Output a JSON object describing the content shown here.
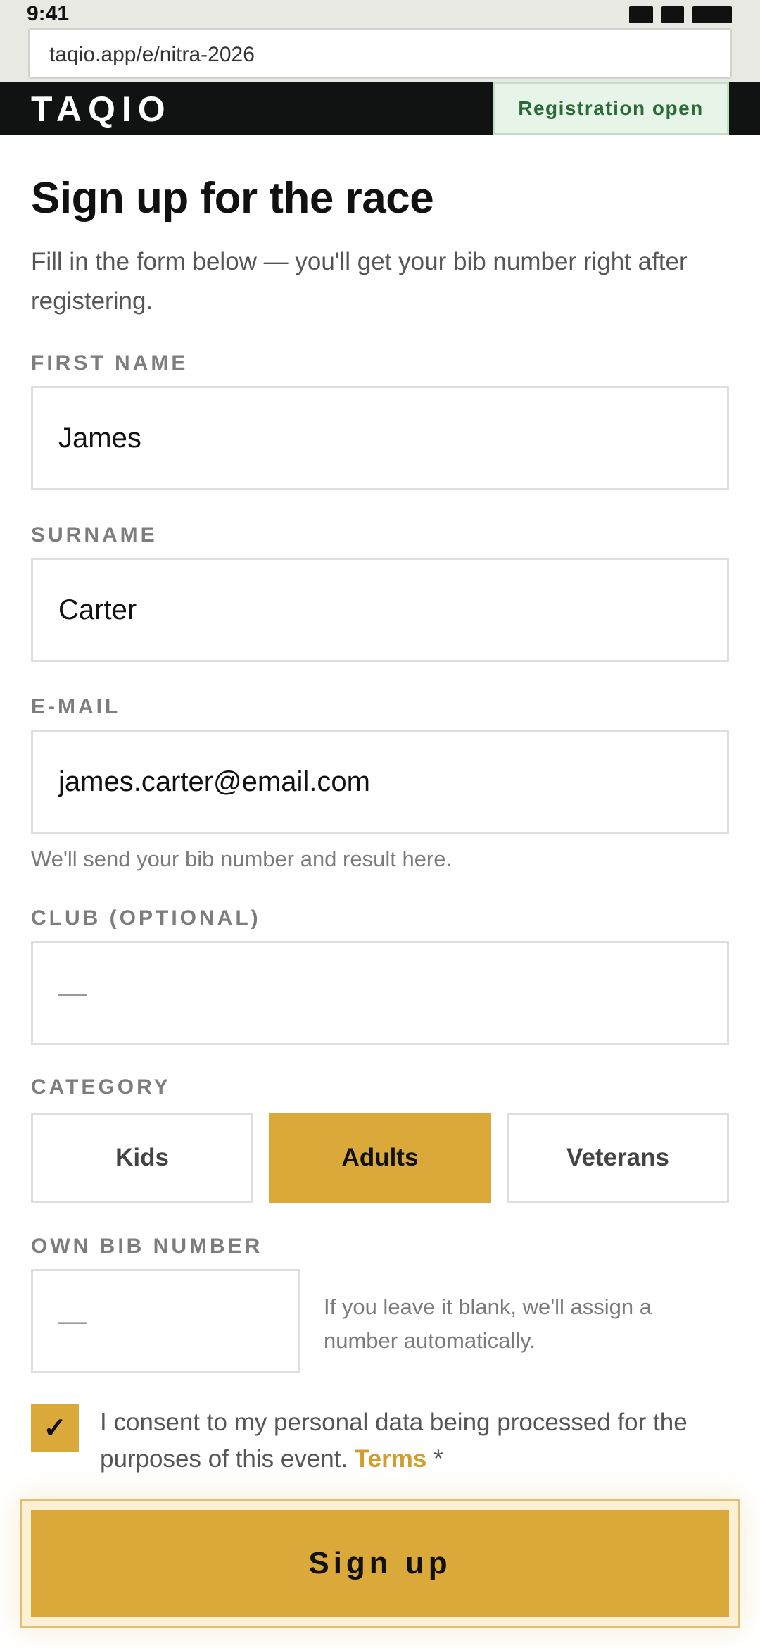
{
  "status_bar": {
    "time": "9:41"
  },
  "browser": {
    "url": "taqio.app/e/nitra-2026"
  },
  "header": {
    "logo": "TAQIO",
    "badge": "Registration open"
  },
  "page": {
    "title": "Sign up for the race",
    "subtitle": "Fill in the form below — you'll get your bib number right after registering."
  },
  "form": {
    "first_name": {
      "label": "FIRST NAME",
      "value": "James"
    },
    "surname": {
      "label": "SURNAME",
      "value": "Carter"
    },
    "email": {
      "label": "E-MAIL",
      "value": "james.carter@email.com",
      "hint": "We'll send your bib number and result here."
    },
    "club": {
      "label": "CLUB (OPTIONAL)",
      "placeholder": "—"
    },
    "category": {
      "label": "CATEGORY",
      "options": [
        "Kids",
        "Adults",
        "Veterans"
      ],
      "selected": "Adults"
    },
    "bib": {
      "label": "OWN BIB NUMBER",
      "placeholder": "—",
      "hint": "If you leave it blank, we'll assign a number automatically."
    },
    "consent": {
      "checked": true,
      "check_glyph": "✓",
      "text": "I consent to my personal data being processed for the purposes of this event.",
      "link": "Terms",
      "required_mark": "*"
    },
    "submit_label": "Sign up"
  },
  "colors": {
    "accent": "#daa93a",
    "header_bg": "#111313",
    "badge_bg": "#e6f5e8",
    "badge_text": "#2d6a3a",
    "link": "#d39d2d"
  }
}
